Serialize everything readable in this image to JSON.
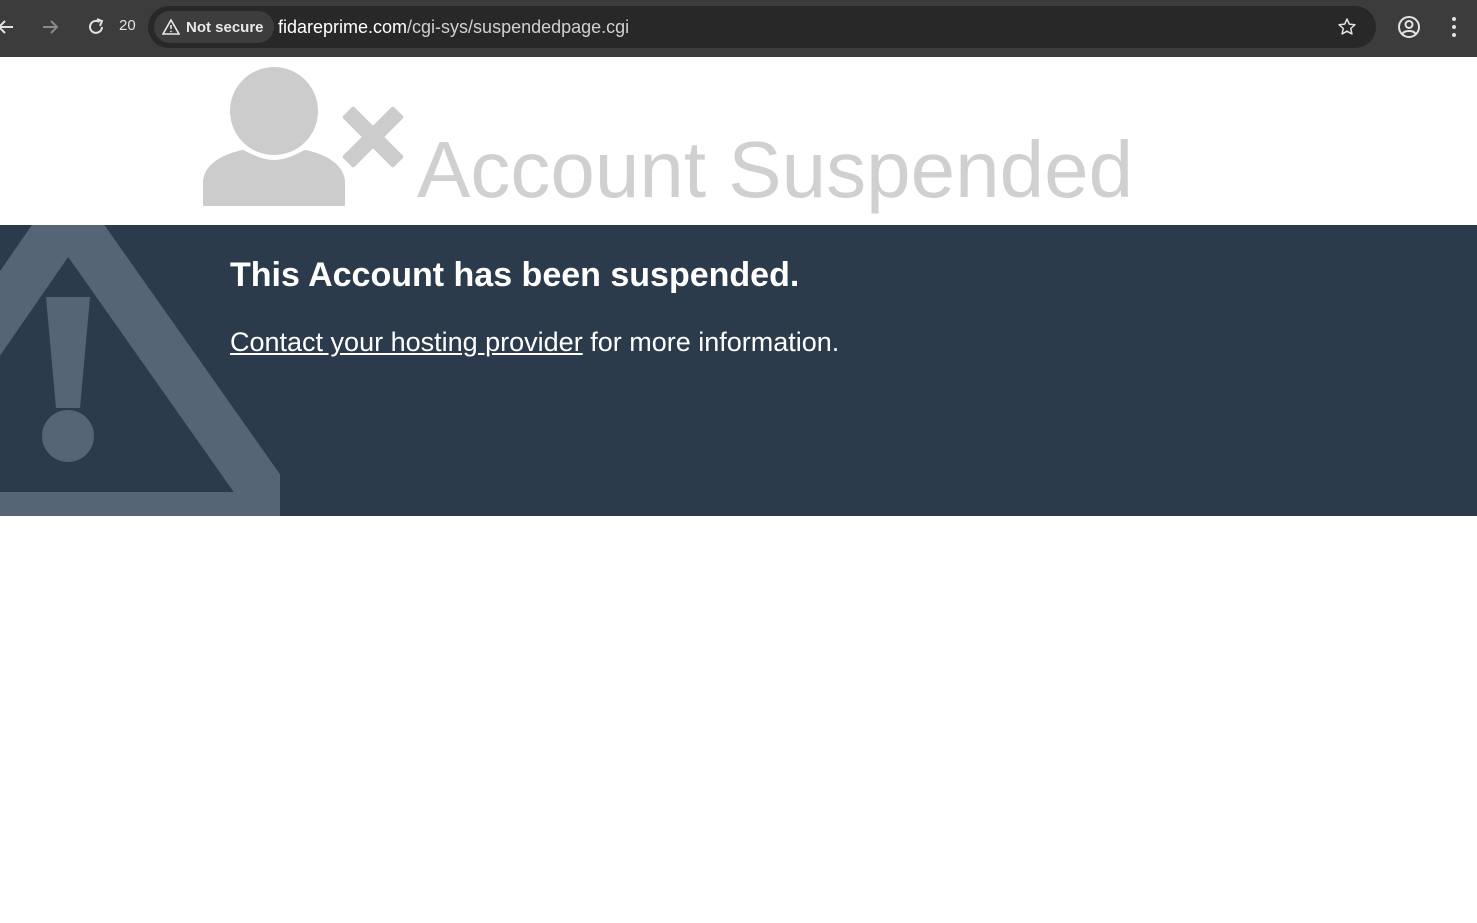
{
  "browser": {
    "back_icon": "arrow-left-icon",
    "forward_icon": "arrow-right-icon",
    "reload_icon": "reload-icon",
    "reload_count": "20",
    "security_label": "Not secure",
    "url_host": "fidareprime.com",
    "url_path": "/cgi-sys/suspendedpage.cgi",
    "star_icon": "star-icon",
    "profile_icon": "profile-icon",
    "menu_icon": "kebab-menu-icon"
  },
  "page": {
    "title": "Account Suspended",
    "heading": "This Account has been suspended.",
    "contact_link": "Contact your hosting provider",
    "contact_suffix": " for more information.",
    "colors": {
      "banner_bg": "#2c3b4b",
      "title_gray": "#d0d0d0",
      "warning_icon": "#566575"
    }
  }
}
